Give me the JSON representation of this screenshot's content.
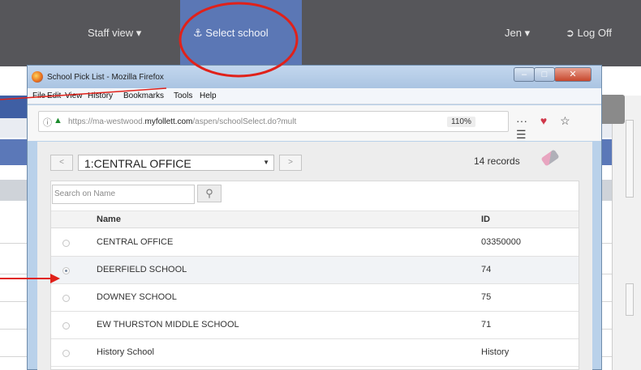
{
  "app": {
    "staff_view_label": "Staff view ▾",
    "select_school_label": "Select school",
    "user_menu_label": "Jen ▾",
    "logoff_label": "Log Off"
  },
  "popup": {
    "window_title": "School Pick List - Mozilla Firefox",
    "menu": [
      "File",
      "Edit",
      "View",
      "History",
      "Bookmarks",
      "Tools",
      "Help"
    ],
    "url_prefix": "https://ma-westwood.",
    "url_domain": "myfollett.com",
    "url_suffix": "/aspen/schoolSelect.do?mult",
    "zoom": "110%",
    "overflow_icon": "···",
    "school_selected": "1:CENTRAL OFFICE",
    "prev_button": "<",
    "next_button": ">",
    "records_count": "14 records",
    "search_placeholder": "Search on Name",
    "columns": {
      "name": "Name",
      "id": "ID"
    },
    "rows": [
      {
        "name": "CENTRAL OFFICE",
        "id": "03350000"
      },
      {
        "name": "DEERFIELD SCHOOL",
        "id": "74"
      },
      {
        "name": "DOWNEY SCHOOL",
        "id": "75"
      },
      {
        "name": "EW THURSTON MIDDLE SCHOOL",
        "id": "71"
      },
      {
        "name": "History School",
        "id": "History"
      }
    ],
    "selected_row_index": 1
  },
  "annotations": {
    "circle_color": "#e0211a",
    "arrow_color": "#e0211a"
  },
  "icons": [
    "bell-icon",
    "logoff-icon",
    "firefox-icon",
    "info-icon",
    "lock-icon",
    "pocket-icon",
    "star-icon",
    "menu-icon",
    "search-icon",
    "eraser-icon"
  ]
}
